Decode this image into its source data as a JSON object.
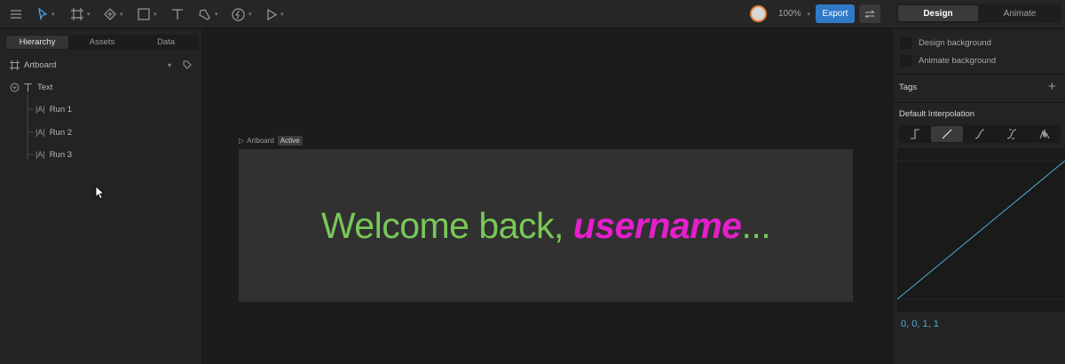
{
  "toolbar": {
    "zoom": "100%",
    "export_label": "Export",
    "modes": [
      {
        "label": "Design",
        "active": true
      },
      {
        "label": "Animate",
        "active": false
      }
    ]
  },
  "left_panel": {
    "tabs": [
      {
        "label": "Hierarchy",
        "active": true
      },
      {
        "label": "Assets",
        "active": false
      },
      {
        "label": "Data",
        "active": false
      }
    ],
    "artboard_label": "Artboard",
    "tree": [
      {
        "label": "Text",
        "icon": "text-icon"
      },
      {
        "label": "Run 1",
        "icon": "text-run-icon"
      },
      {
        "label": "Run 2",
        "icon": "text-run-icon"
      },
      {
        "label": "Run 3",
        "icon": "text-run-icon"
      }
    ]
  },
  "stage": {
    "artboard_name": "Artboard",
    "artboard_badge": "Active",
    "text_plain": "Welcome back, ",
    "text_emphasis": "username",
    "text_suffix": "..."
  },
  "right_panel": {
    "design_background": "Design background",
    "animate_background": "Animate background",
    "tags_label": "Tags",
    "interpolation_title": "Default Interpolation",
    "interpolation_selected": "linear",
    "curve_values": "0, 0, 1, 1"
  },
  "colors": {
    "accent": "#2f79c6",
    "text_green": "#78c957",
    "text_magenta": "#e41fcc",
    "curve": "#49b0d8"
  }
}
